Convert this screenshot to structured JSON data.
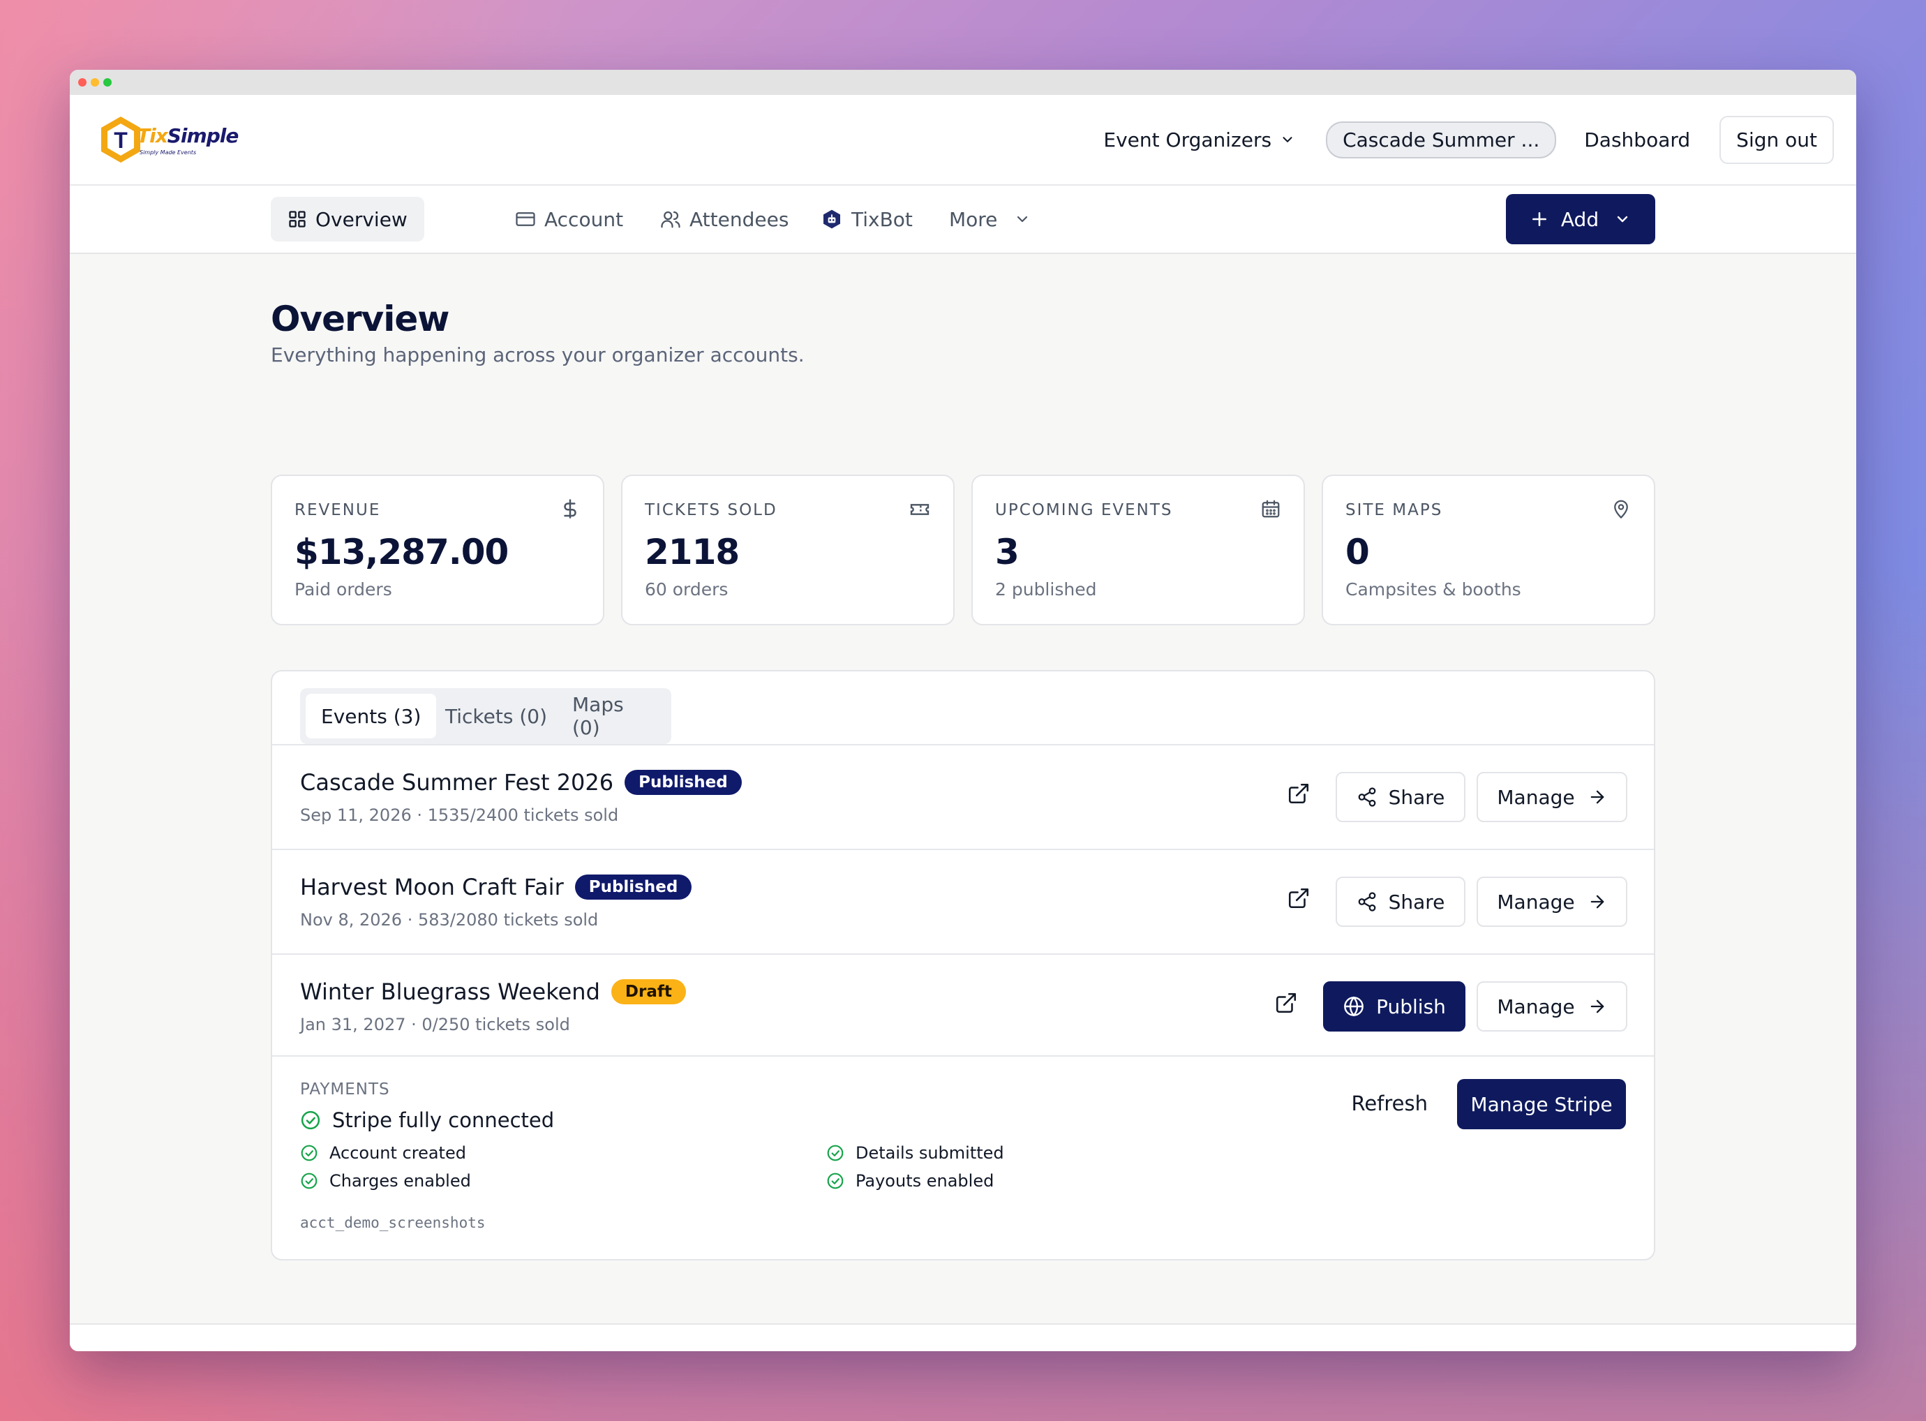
{
  "app": {
    "brand_tix": "Tix",
    "brand_simple": "Simple",
    "tagline": "Simply Made Events"
  },
  "topbar": {
    "org_selector": "Event Organizers",
    "event_pill": "Cascade Summer ...",
    "dashboard": "Dashboard",
    "sign_out": "Sign out"
  },
  "subnav": {
    "tabs": [
      {
        "label": "Overview",
        "icon": "grid-icon",
        "active": true
      },
      {
        "label": "Account",
        "icon": "card-icon"
      },
      {
        "label": "Attendees",
        "icon": "users-icon"
      },
      {
        "label": "TixBot",
        "icon": "bot-icon"
      },
      {
        "label": "More",
        "icon": "chevron-down-icon"
      }
    ],
    "add_label": "Add"
  },
  "page": {
    "title": "Overview",
    "subtitle": "Everything happening across your organizer accounts."
  },
  "stats": [
    {
      "label": "REVENUE",
      "value": "$13,287.00",
      "note": "Paid orders",
      "icon": "dollar-icon"
    },
    {
      "label": "TICKETS SOLD",
      "value": "2118",
      "note": "60 orders",
      "icon": "ticket-icon"
    },
    {
      "label": "UPCOMING EVENTS",
      "value": "3",
      "note": "2 published",
      "icon": "calendar-icon"
    },
    {
      "label": "SITE MAPS",
      "value": "0",
      "note": "Campsites & booths",
      "icon": "map-pin-icon"
    }
  ],
  "panel": {
    "tabs": [
      {
        "label": "Events (3)",
        "active": true
      },
      {
        "label": "Tickets (0)"
      },
      {
        "label": "Maps (0)"
      }
    ],
    "events": [
      {
        "title": "Cascade Summer Fest 2026",
        "status": "Published",
        "meta": "Sep 11, 2026 · 1535/2400 tickets sold",
        "primary": "Share",
        "manage": "Manage"
      },
      {
        "title": "Harvest Moon Craft Fair",
        "status": "Published",
        "meta": "Nov 8, 2026 · 583/2080 tickets sold",
        "primary": "Share",
        "manage": "Manage"
      },
      {
        "title": "Winter Bluegrass Weekend",
        "status": "Draft",
        "meta": "Jan 31, 2027 · 0/250 tickets sold",
        "primary": "Publish",
        "manage": "Manage"
      }
    ]
  },
  "payments": {
    "label": "PAYMENTS",
    "status": "Stripe fully connected",
    "checks": [
      "Account created",
      "Charges enabled",
      "Details submitted",
      "Payouts enabled"
    ],
    "account_id": "acct_demo_screenshots",
    "refresh": "Refresh",
    "manage_stripe": "Manage Stripe"
  },
  "colors": {
    "primary": "#0f1a5e",
    "published_badge": "#101a6b",
    "draft_badge": "#fbb216",
    "success_green": "#16a34a",
    "brand_orange": "#f3a712"
  }
}
